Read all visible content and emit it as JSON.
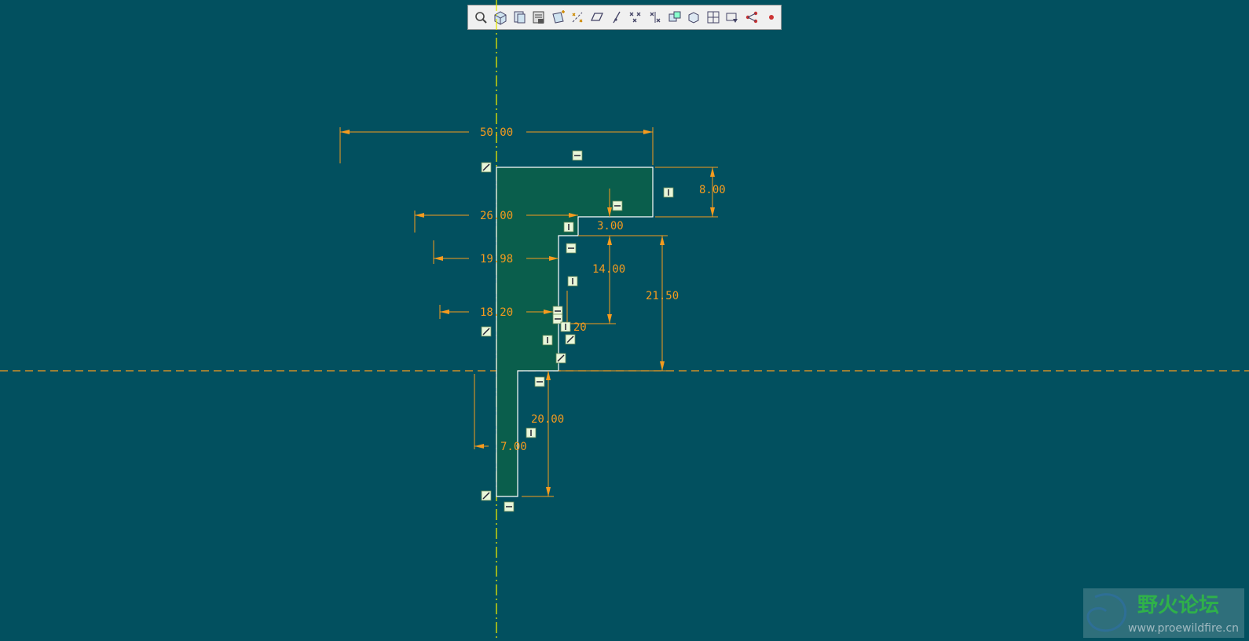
{
  "toolbar": {
    "buttons": [
      {
        "name": "zoom-fit-icon"
      },
      {
        "name": "view-3d-icon"
      },
      {
        "name": "saved-views-icon"
      },
      {
        "name": "layers-icon"
      },
      {
        "name": "datum-plane-icon"
      },
      {
        "name": "datum-axis-icon"
      },
      {
        "name": "datum-plane-display-icon"
      },
      {
        "name": "datum-axis-display-icon"
      },
      {
        "name": "datum-point-display-icon"
      },
      {
        "name": "coordinate-system-display-icon"
      },
      {
        "name": "annotation-display-icon"
      },
      {
        "name": "spin-center-icon"
      },
      {
        "name": "model-tree-icon"
      },
      {
        "name": "dimension-display-icon"
      },
      {
        "name": "constraint-display-icon"
      },
      {
        "name": "vertex-display-icon"
      }
    ]
  },
  "dimensions": {
    "width_total": "50.00",
    "step_26": "26.00",
    "dia_1998": "19.98",
    "dia_1820": "18.20",
    "dia_700": "7.00",
    "height_8": "8.00",
    "step_3": "3.00",
    "height_14": "14.00",
    "height_2150": "21.50",
    "height_20": "20.00",
    "small_120": "1.20"
  },
  "watermark": {
    "title": "野火论坛",
    "url": "www.proewildfire.cn"
  },
  "colors": {
    "background": "#02505f",
    "section_fill": "#0a5e4c",
    "dimension": "#f59b1e",
    "centerline": "#e8e800",
    "sketch_line": "#ffffff"
  }
}
